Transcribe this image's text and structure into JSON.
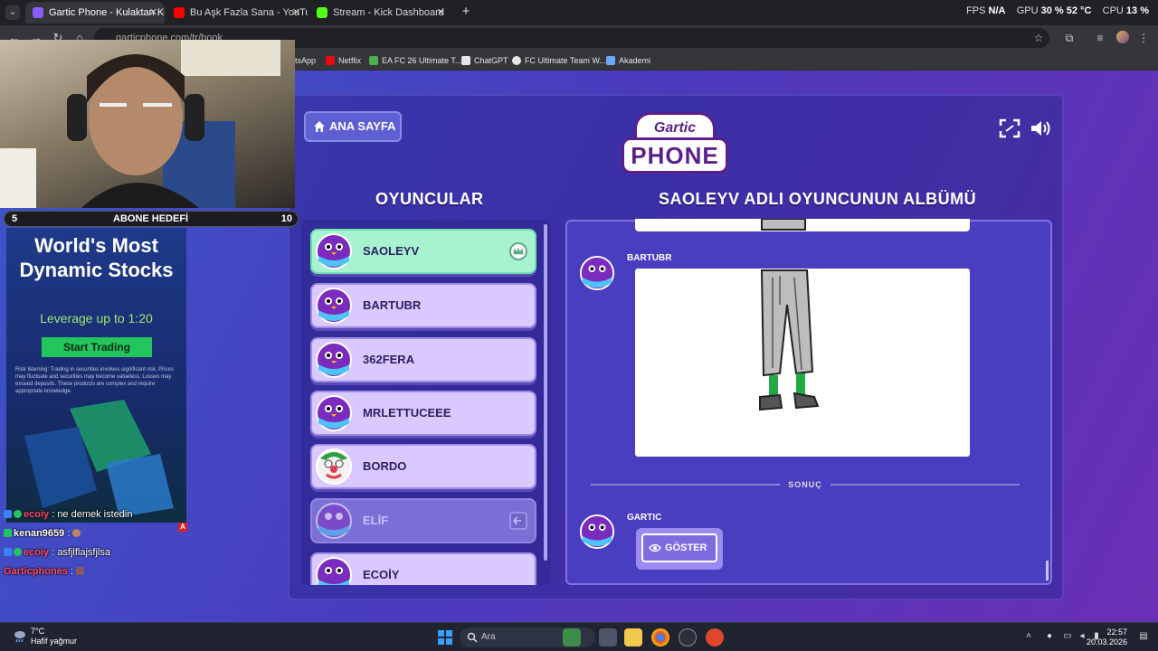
{
  "browser": {
    "tabs": [
      {
        "title": "Gartic Phone - Kulaktan Kulağa",
        "active": true
      },
      {
        "title": "Bu Aşk Fazla Sana - YouTube",
        "active": false
      },
      {
        "title": "Stream - Kick Dashboard",
        "active": false
      }
    ],
    "url": "garticphone.com/tr/book",
    "stats": {
      "fps_label": "FPS",
      "fps_value": "N/A",
      "gpu_label": "GPU",
      "gpu_value": "30 %  52 °C",
      "cpu_label": "CPU",
      "cpu_value": "13 %"
    },
    "bookmarks": [
      "tsApp",
      "Netflix",
      "EA FC 26 Ultimate T...",
      "ChatGPT",
      "FC Ultimate Team W...",
      "Akademi"
    ]
  },
  "game": {
    "home_button": "ANA SAYFA",
    "logo_top": "Gartic",
    "logo_bottom": "PHONE",
    "players_title": "OYUNCULAR",
    "album_title": "SAOLEYV ADLI OYUNCUNUN ALBÜMÜ",
    "players": [
      {
        "name": "SAOLEYV",
        "state": "host"
      },
      {
        "name": "BARTUBR",
        "state": "normal"
      },
      {
        "name": "362FERA",
        "state": "normal"
      },
      {
        "name": "MRLETTUCEEE",
        "state": "normal"
      },
      {
        "name": "BORDO",
        "state": "normal"
      },
      {
        "name": "ELİF",
        "state": "left"
      },
      {
        "name": "ECOİY",
        "state": "normal"
      }
    ],
    "album": {
      "drawing_author": "BARTUBR",
      "divider_label": "SONUÇ",
      "result_author": "GARTIC",
      "show_button": "GÖSTER"
    }
  },
  "overlay": {
    "goal": {
      "min": "5",
      "label": "ABONE HEDEFİ",
      "max": "10"
    },
    "ad": {
      "title": "World's Most Dynamic Stocks",
      "subtitle": "Leverage up to 1:20",
      "button": "Start Trading",
      "risk": "Risk Warning: Trading in securities involves significant risk. Prices may fluctuate and securities may become valueless. Losses may exceed deposits. These products are complex and require appropriate knowledge."
    },
    "chat": [
      {
        "user": "ecoiy",
        "sep": " : ",
        "text": "ne demek istedin",
        "color": "#ff4d6d"
      },
      {
        "user": "kenan9659",
        "sep": " : ",
        "text": "",
        "color": "#ffffff"
      },
      {
        "user": "ecoiy",
        "sep": " : ",
        "text": "asfjlflajsfjlsa",
        "color": "#ff4d6d"
      },
      {
        "user": "Garticphones",
        "sep": " : ",
        "text": "",
        "color": "#ff4d6d"
      }
    ]
  },
  "taskbar": {
    "weather_temp": "7°C",
    "weather_desc": "Hafif yağmur",
    "search_placeholder": "Ara",
    "time": "22:57",
    "date": "20.03.2026"
  }
}
